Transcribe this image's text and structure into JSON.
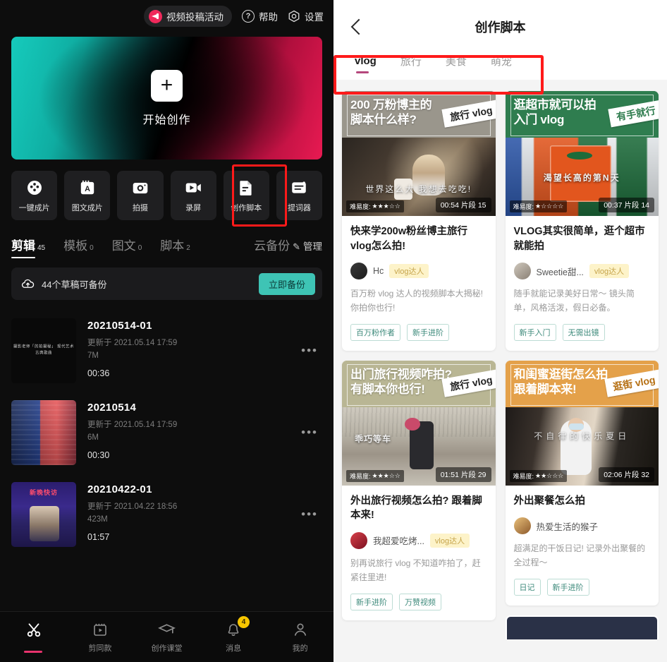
{
  "left": {
    "header": {
      "activity_label": "视频投稿活动",
      "help_label": "帮助",
      "settings_label": "设置"
    },
    "banner": {
      "cta": "开始创作",
      "plus": "+"
    },
    "tools": [
      {
        "label": "一键成片",
        "icon": "film-reel-icon"
      },
      {
        "label": "图文成片",
        "icon": "text-image-icon"
      },
      {
        "label": "拍摄",
        "icon": "camera-icon"
      },
      {
        "label": "录屏",
        "icon": "screen-record-icon"
      },
      {
        "label": "创作脚本",
        "icon": "script-document-icon"
      },
      {
        "label": "提词器",
        "icon": "teleprompter-icon"
      }
    ],
    "tabs": [
      {
        "label": "剪辑",
        "count": "45",
        "active": true
      },
      {
        "label": "模板",
        "count": "0",
        "active": false
      },
      {
        "label": "图文",
        "count": "0",
        "active": false
      },
      {
        "label": "脚本",
        "count": "2",
        "active": false
      }
    ],
    "cloud_backup_label": "云备份",
    "manage_label": "管理",
    "backup_bar": {
      "text": "44个草稿可备份",
      "button": "立即备份"
    },
    "drafts": [
      {
        "title": "20210514-01",
        "updated": "更新于 2021.05.14 17:59",
        "size": "7M",
        "duration": "00:36",
        "thumb_text": "摄影老师「的拍摄秘」\n现代艺术古典歌曲",
        "thumb_style": "dark"
      },
      {
        "title": "20210514",
        "updated": "更新于 2021.05.14 17:59",
        "size": "6M",
        "duration": "00:30",
        "thumb_text": "",
        "thumb_style": "edit"
      },
      {
        "title": "20210422-01",
        "updated": "更新于 2021.04.22 18:56",
        "size": "423M",
        "duration": "01:57",
        "thumb_text": "新晚快访",
        "thumb_style": "news"
      }
    ],
    "nav": [
      {
        "label": "剪辑",
        "icon": "scissors-icon",
        "active": true,
        "badge": ""
      },
      {
        "label": "剪同款",
        "icon": "video-template-icon",
        "active": false,
        "badge": ""
      },
      {
        "label": "创作课堂",
        "icon": "graduation-cap-icon",
        "active": false,
        "badge": ""
      },
      {
        "label": "消息",
        "icon": "bell-icon",
        "active": false,
        "badge": "4"
      },
      {
        "label": "我的",
        "icon": "person-icon",
        "active": false,
        "badge": ""
      }
    ]
  },
  "right": {
    "title": "创作脚本",
    "categories": [
      {
        "label": "vlog",
        "active": true
      },
      {
        "label": "旅行",
        "active": false
      },
      {
        "label": "美食",
        "active": false
      },
      {
        "label": "萌宠",
        "active": false
      }
    ],
    "cards": [
      {
        "cover_title_line1": "200 万粉博主的",
        "cover_title_line2": "脚本什么样?",
        "ribbon": "旅行 vlog",
        "caption": "世界这么大 我想去吃吃!",
        "difficulty_label": "难易度:",
        "stars": "★★★☆☆",
        "duration": "00:54 片段 15",
        "title": "快来学200w粉丝博主旅行vlog怎么拍!",
        "author": "Hc",
        "author_badge": "vlog达人",
        "desc": "百万粉 vlog 达人的视频脚本大揭秘! 你拍你也行!",
        "tags": [
          "百万粉作者",
          "新手进阶"
        ],
        "theme": "gray"
      },
      {
        "cover_title_line1": "逛超市就可以拍",
        "cover_title_line2": "入门 vlog",
        "ribbon": "有手就行",
        "caption": "渴望长高的第N天",
        "difficulty_label": "难易度:",
        "stars": "★☆☆☆☆",
        "duration": "00:37 片段 14",
        "title": "VLOG其实很简单，逛个超市就能拍",
        "author": "Sweetie甜...",
        "author_badge": "vlog达人",
        "desc": "随手就能记录美好日常～ 镜头简单，风格活泼，假日必备。",
        "tags": [
          "新手入门",
          "无需出镜"
        ],
        "theme": "green"
      },
      {
        "cover_title_line1": "出门旅行视频咋拍?",
        "cover_title_line2": "有脚本你也行!",
        "ribbon": "旅行 vlog",
        "caption": "乖巧等车",
        "difficulty_label": "难易度:",
        "stars": "★★★☆☆",
        "duration": "01:51 片段 29",
        "title": "外出旅行视频怎么拍? 跟着脚本来!",
        "author": "我超爱吃烤...",
        "author_badge": "vlog达人",
        "desc": "别再说旅行 vlog 不知道咋拍了，赶紧往里进!",
        "tags": [
          "新手进阶",
          "万赞视频"
        ],
        "theme": "olive"
      },
      {
        "cover_title_line1": "和闺蜜逛街怎么拍",
        "cover_title_line2": "跟着脚本来!",
        "ribbon": "逛街 vlog",
        "caption": "不自律的快乐夏日",
        "difficulty_label": "难易度:",
        "stars": "★★☆☆☆",
        "duration": "02:06 片段 32",
        "title": "外出聚餐怎么拍",
        "author": "热爱生活的猴子",
        "author_badge": "",
        "desc": "超满足的干饭日记! 记录外出聚餐的全过程～",
        "tags": [
          "日记",
          "新手进阶"
        ],
        "theme": "orange"
      }
    ]
  }
}
